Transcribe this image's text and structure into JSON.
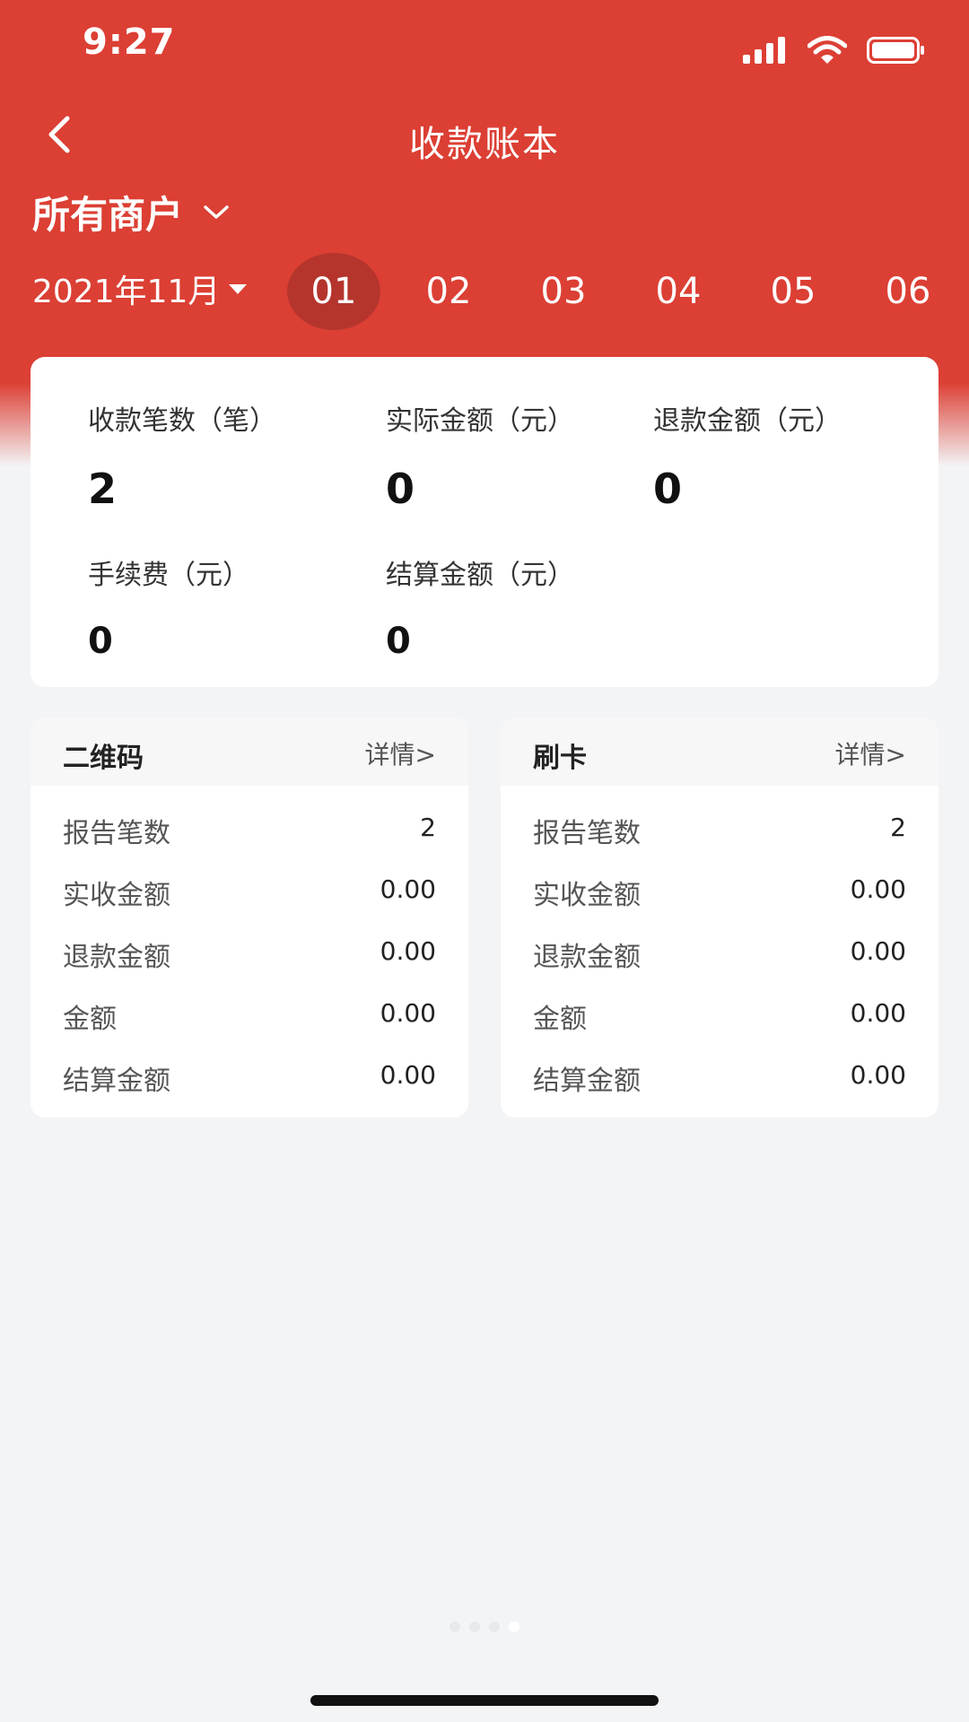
{
  "status_bar": {
    "time": "9:27",
    "icons": [
      "signal-icon",
      "wifi-icon",
      "battery-icon"
    ]
  },
  "header": {
    "title": "收款账本",
    "back_icon": "chevron-left-icon",
    "merchant": "所有商户",
    "merchant_icon": "chevron-down-icon"
  },
  "date_bar": {
    "month": "2021年11月",
    "month_icon": "caret-down-icon",
    "days": [
      "01",
      "02",
      "03",
      "04",
      "05",
      "06"
    ],
    "selected_day": "01"
  },
  "summary": {
    "count_label": "收款笔数（笔）",
    "count_value": "2",
    "actual_label": "实际金额（元）",
    "actual_value": "0",
    "refund_label": "退款金额（元）",
    "refund_value": "0",
    "fee_label": "手续费（元）",
    "fee_value": "0",
    "settle_label": "结算金额（元）",
    "settle_value": "0"
  },
  "cards": [
    {
      "title": "二维码",
      "link": "详情>",
      "rows": [
        {
          "label": "报告笔数",
          "value": "2"
        },
        {
          "label": "实收金额",
          "value": "0.00"
        },
        {
          "label": "退款金额",
          "value": "0.00"
        },
        {
          "label": "金额",
          "value": "0.00"
        },
        {
          "label": "结算金额",
          "value": "0.00"
        }
      ]
    },
    {
      "title": "刷卡",
      "link": "详情>",
      "rows": [
        {
          "label": "报告笔数",
          "value": "2"
        },
        {
          "label": "实收金额",
          "value": "0.00"
        },
        {
          "label": "退款金额",
          "value": "0.00"
        },
        {
          "label": "金额",
          "value": "0.00"
        },
        {
          "label": "结算金额",
          "value": "0.00"
        }
      ]
    }
  ],
  "colors": {
    "brand_red": "#dc3f34",
    "selected_day_bg": "#b5352d",
    "page_bg": "#f3f4f6"
  }
}
